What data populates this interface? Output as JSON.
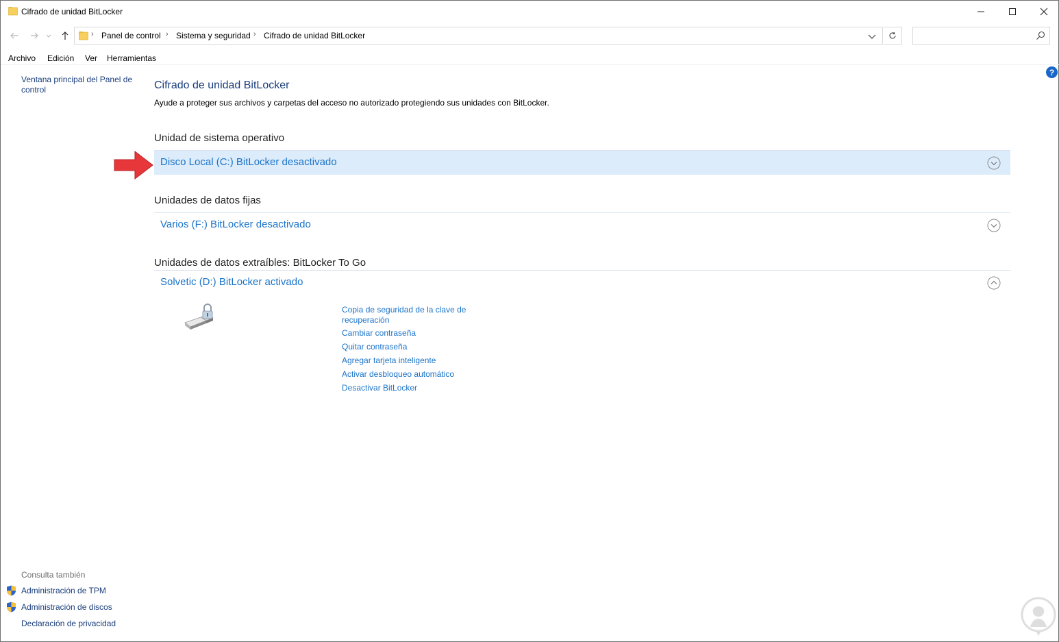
{
  "window": {
    "title": "Cifrado de unidad BitLocker",
    "controls": {
      "minimize": "minimize-icon",
      "maximize": "maximize-icon",
      "close": "close-icon"
    }
  },
  "address_bar": {
    "breadcrumbs": [
      "Panel de control",
      "Sistema y seguridad",
      "Cifrado de unidad BitLocker"
    ],
    "search_placeholder": ""
  },
  "menu": [
    "Archivo",
    "Edición",
    "Ver",
    "Herramientas"
  ],
  "sidebar": {
    "home_link": "Ventana principal del Panel de control",
    "see_also_heading": "Consulta también",
    "see_also_items": [
      {
        "label": "Administración de TPM",
        "icon": "shield-icon"
      },
      {
        "label": "Administración de discos",
        "icon": "shield-icon"
      },
      {
        "label": "Declaración de privacidad",
        "icon": ""
      }
    ]
  },
  "main": {
    "title": "Cifrado de unidad BitLocker",
    "description": "Ayude a proteger sus archivos y carpetas del acceso no autorizado protegiendo sus unidades con BitLocker.",
    "sections": [
      {
        "heading": "Unidad de sistema operativo",
        "drives": [
          {
            "label": "Disco Local (C:) BitLocker desactivado",
            "expanded": false,
            "highlighted": true
          }
        ]
      },
      {
        "heading": "Unidades de datos fijas",
        "drives": [
          {
            "label": "Varios (F:) BitLocker desactivado",
            "expanded": false,
            "highlighted": false
          }
        ]
      },
      {
        "heading": "Unidades de datos extraíbles: BitLocker To Go",
        "drives": [
          {
            "label": "Solvetic (D:) BitLocker activado",
            "expanded": true,
            "highlighted": false,
            "actions": [
              "Copia de seguridad de la clave de recuperación",
              "Cambiar contraseña",
              "Quitar contraseña",
              "Agregar tarjeta inteligente",
              "Activar desbloqueo automático",
              "Desactivar BitLocker"
            ]
          }
        ]
      }
    ]
  },
  "colors": {
    "link": "#1a73c9",
    "heading_link": "#1a3d7c",
    "row_highlight": "#dcecfa",
    "arrow": "#e8373a"
  }
}
